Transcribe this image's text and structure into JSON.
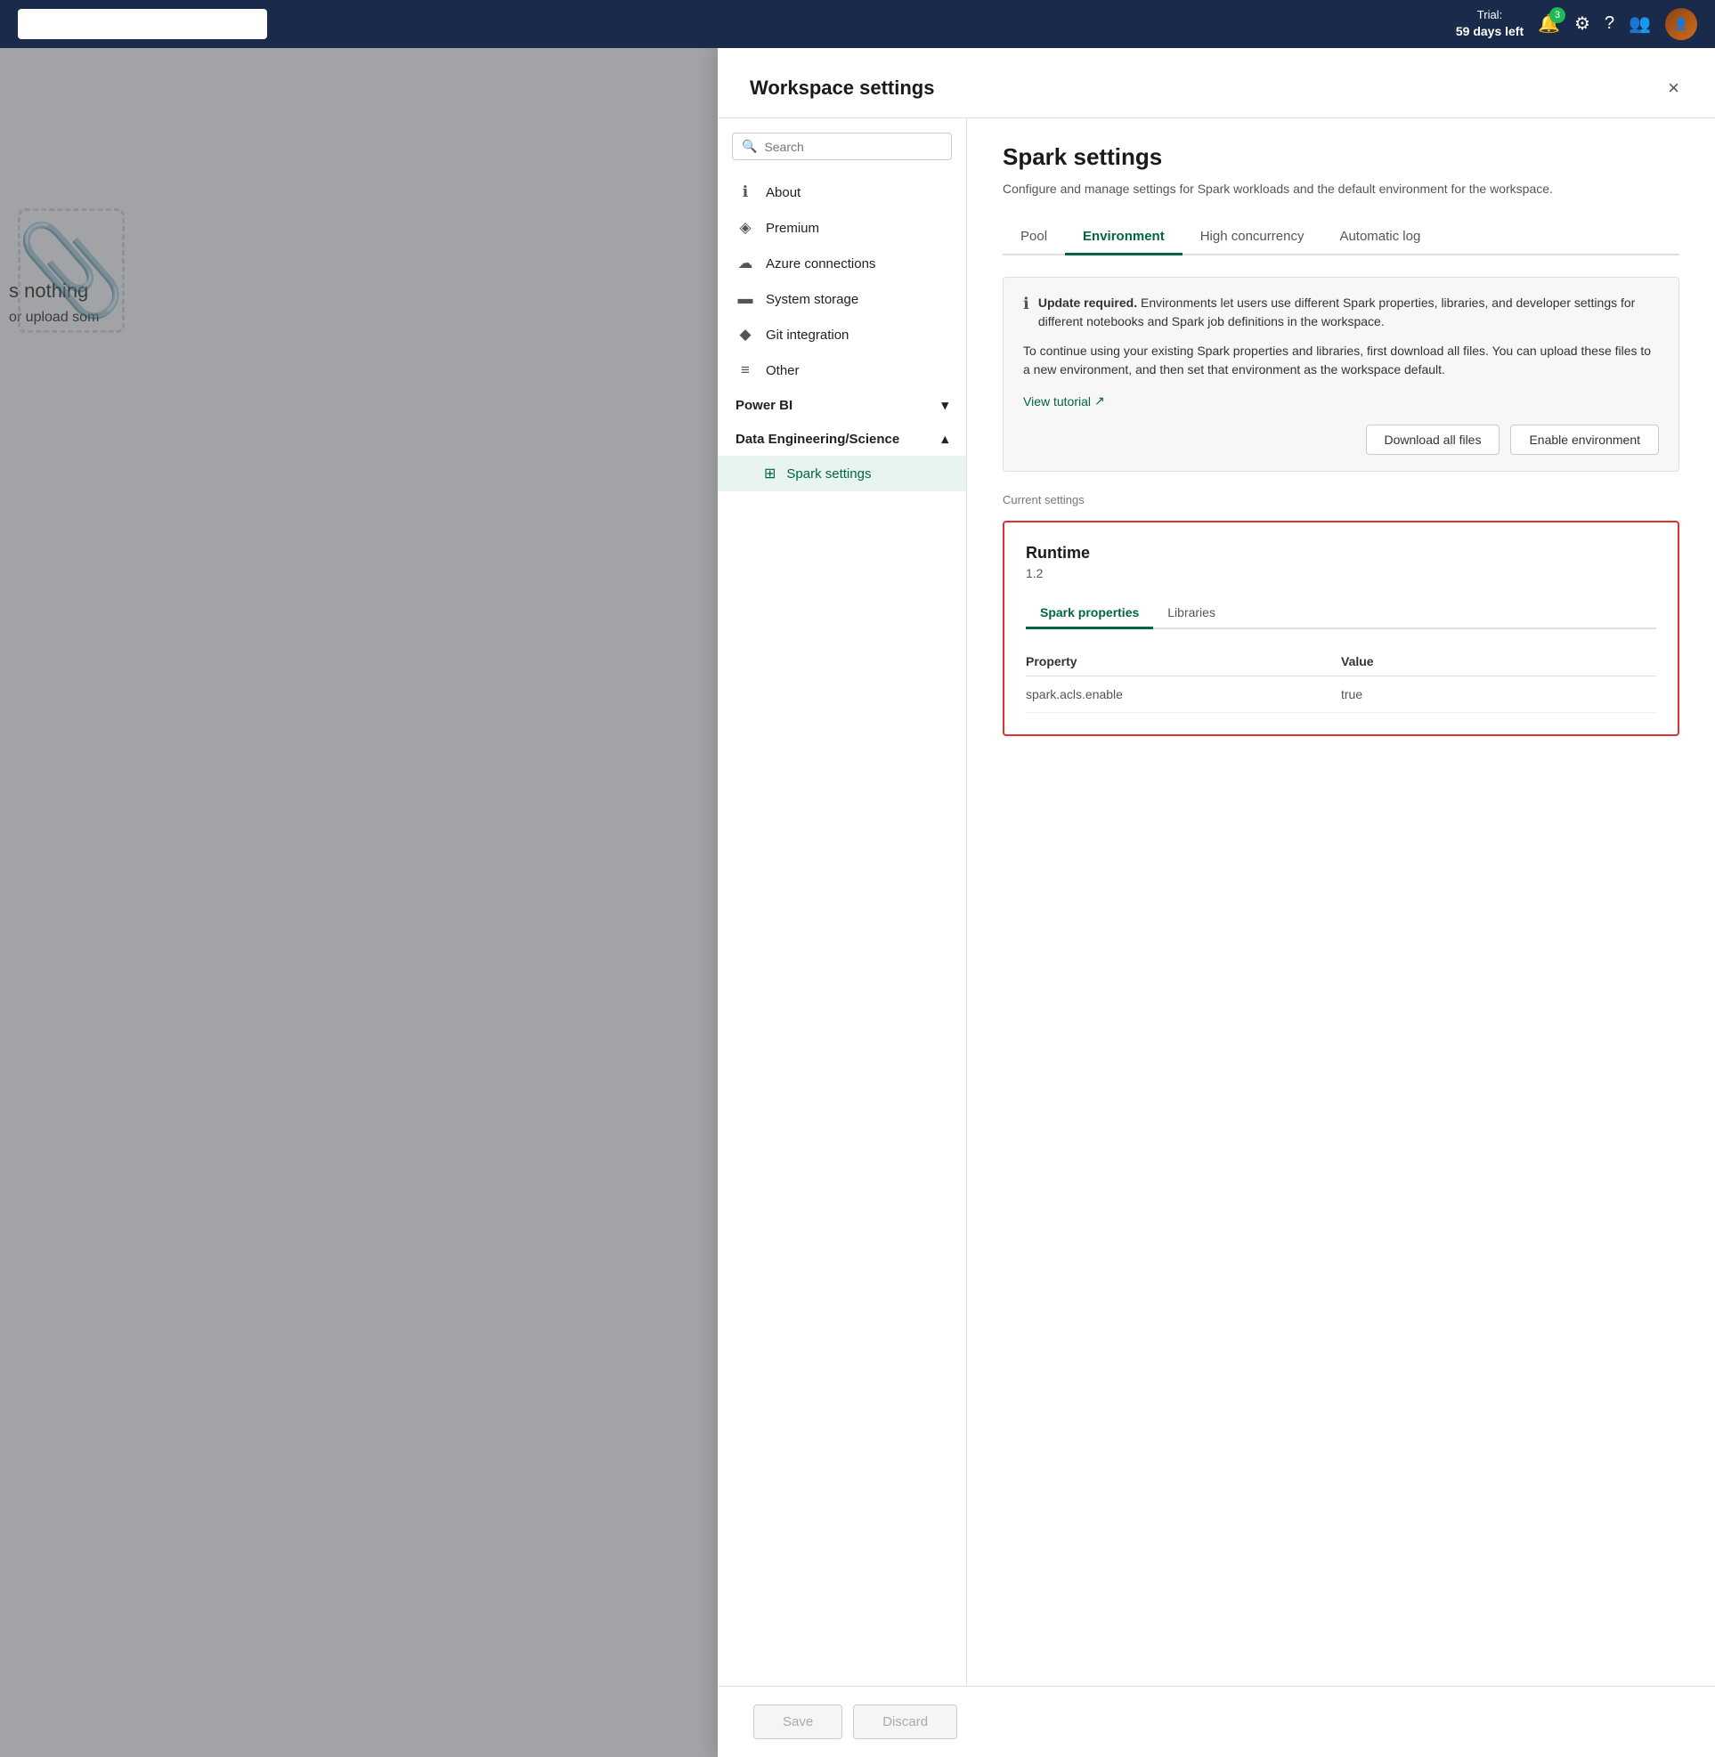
{
  "topbar": {
    "trial_label": "Trial:",
    "trial_days": "59 days left",
    "notification_count": "3"
  },
  "modal": {
    "title": "Workspace settings",
    "close_label": "×"
  },
  "sidebar": {
    "search_placeholder": "Search",
    "items": [
      {
        "id": "about",
        "label": "About",
        "icon": "ℹ"
      },
      {
        "id": "premium",
        "label": "Premium",
        "icon": "◈"
      },
      {
        "id": "azure-connections",
        "label": "Azure connections",
        "icon": "☁"
      },
      {
        "id": "system-storage",
        "label": "System storage",
        "icon": "▬"
      },
      {
        "id": "git-integration",
        "label": "Git integration",
        "icon": "◆"
      },
      {
        "id": "other",
        "label": "Other",
        "icon": "≡"
      }
    ],
    "groups": [
      {
        "id": "power-bi",
        "label": "Power BI",
        "expanded": false,
        "subitems": []
      },
      {
        "id": "data-engineering",
        "label": "Data Engineering/Science",
        "expanded": true,
        "subitems": [
          {
            "id": "spark-settings",
            "label": "Spark settings",
            "icon": "⊞",
            "active": true
          }
        ]
      }
    ]
  },
  "page": {
    "title": "Spark settings",
    "description": "Configure and manage settings for Spark workloads and the default environment for the workspace.",
    "tabs": [
      {
        "id": "pool",
        "label": "Pool",
        "active": false
      },
      {
        "id": "environment",
        "label": "Environment",
        "active": true
      },
      {
        "id": "high-concurrency",
        "label": "High concurrency",
        "active": false
      },
      {
        "id": "automatic-log",
        "label": "Automatic log",
        "active": false
      }
    ]
  },
  "alert": {
    "icon": "ℹ",
    "text_bold": "Update required.",
    "text_main": " Environments let users use different Spark properties, libraries, and developer settings for different notebooks and Spark job definitions in the workspace.",
    "description": "To continue using your existing Spark properties and libraries, first download all files. You can upload these files to a new environment, and then set that environment as the workspace default.",
    "link_label": "View tutorial",
    "link_icon": "↗",
    "btn_download": "Download all files",
    "btn_enable": "Enable environment"
  },
  "current_settings": {
    "section_label": "Current settings",
    "runtime_title": "Runtime",
    "runtime_version": "1.2",
    "inner_tabs": [
      {
        "id": "spark-properties",
        "label": "Spark properties",
        "active": true
      },
      {
        "id": "libraries",
        "label": "Libraries",
        "active": false
      }
    ],
    "table": {
      "col_property": "Property",
      "col_value": "Value",
      "rows": [
        {
          "property": "spark.acls.enable",
          "value": "true"
        }
      ]
    }
  },
  "footer": {
    "save_label": "Save",
    "discard_label": "Discard"
  },
  "background": {
    "nothing_text": "s nothing",
    "upload_text": "or upload som"
  }
}
